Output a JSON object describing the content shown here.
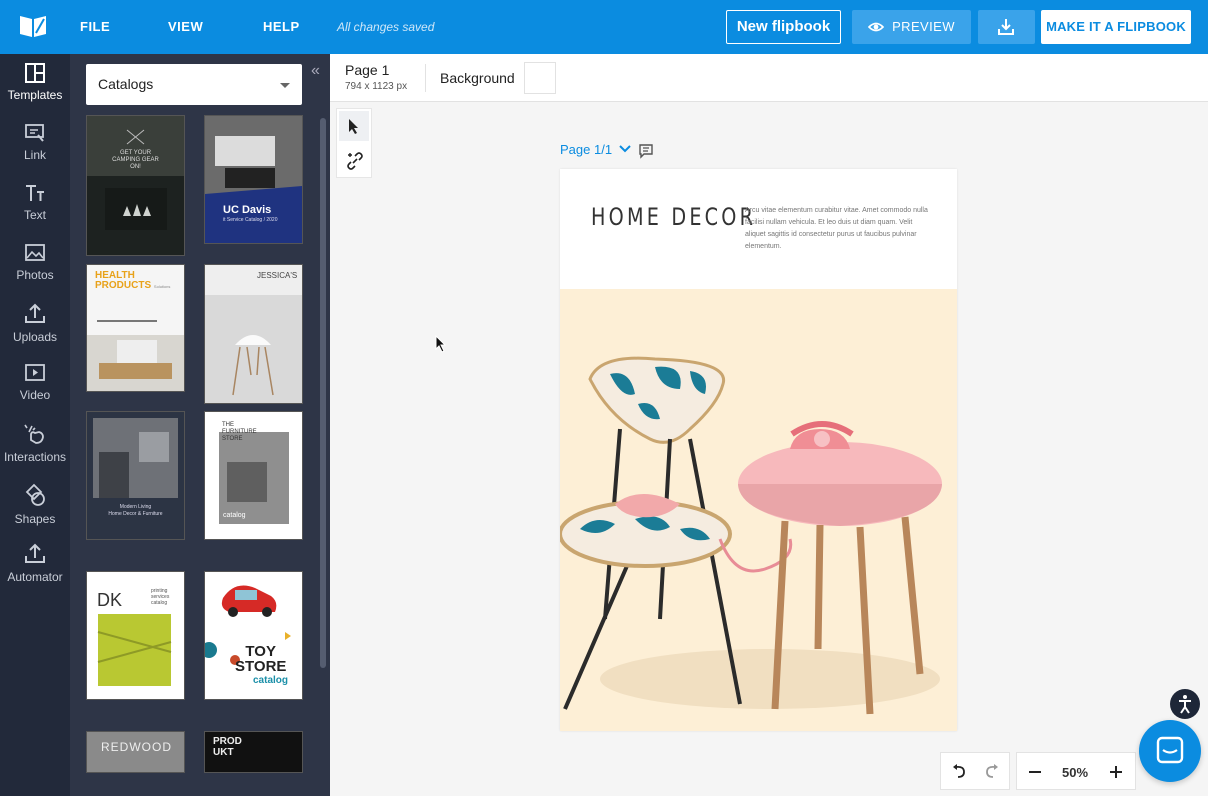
{
  "topbar": {
    "menu": [
      "FILE",
      "VIEW",
      "HELP"
    ],
    "saved_status": "All changes saved",
    "new_flipbook": "New flipbook",
    "preview": "PREVIEW",
    "make_flipbook": "MAKE IT A FLIPBOOK",
    "accent_color": "#0b8ce0"
  },
  "leftnav": {
    "items": [
      {
        "label": "Templates",
        "icon": "templates-icon"
      },
      {
        "label": "Link",
        "icon": "link-icon"
      },
      {
        "label": "Text",
        "icon": "text-icon"
      },
      {
        "label": "Photos",
        "icon": "photos-icon"
      },
      {
        "label": "Uploads",
        "icon": "uploads-icon"
      },
      {
        "label": "Video",
        "icon": "video-icon"
      },
      {
        "label": "Interactions",
        "icon": "interactions-icon"
      },
      {
        "label": "Shapes",
        "icon": "shapes-icon"
      },
      {
        "label": "Automator",
        "icon": "automator-icon"
      }
    ]
  },
  "panel": {
    "dropdown": "Catalogs",
    "templates": [
      {
        "line1": "GET YOUR",
        "line2": "CAMPING GEAR",
        "line3": "ON!"
      },
      {
        "line1": "UC Davis",
        "line2": "it Service Catalog / 2020"
      },
      {
        "line1": "HEALTH",
        "line2": "PRODUCTS",
        "line3": "Solutions"
      },
      {
        "line1": "JESSICA'S"
      },
      {
        "line1": "Modern Living",
        "line2": "Home Decor & Furniture"
      },
      {
        "line1": "THE",
        "line2": "FURNITURE",
        "line3": "STORE",
        "line4": "catalog"
      },
      {
        "line1": "DK",
        "line2": "printing",
        "line3": "services",
        "line4": "catalog"
      },
      {
        "line1": "TOY",
        "line2": "STORE",
        "line3": "catalog"
      },
      {
        "line1": "REDWOOD"
      },
      {
        "line1": "PROD",
        "line2": "UKT"
      }
    ]
  },
  "canvas": {
    "page_label": "Page 1",
    "page_size": "794 x 1123 px",
    "background_label": "Background",
    "page_indicator": "Page 1/1",
    "page_title": "HOME DECOR",
    "page_paragraph": "Arcu vitae elementum curabitur vitae. Amet commodo nulla facilisi nullam vehicula. Et leo duis ut diam quam. Velit aliquet sagittis id consectetur purus ut faucibus pulvinar elementum."
  },
  "zoom": {
    "value": "50%"
  }
}
